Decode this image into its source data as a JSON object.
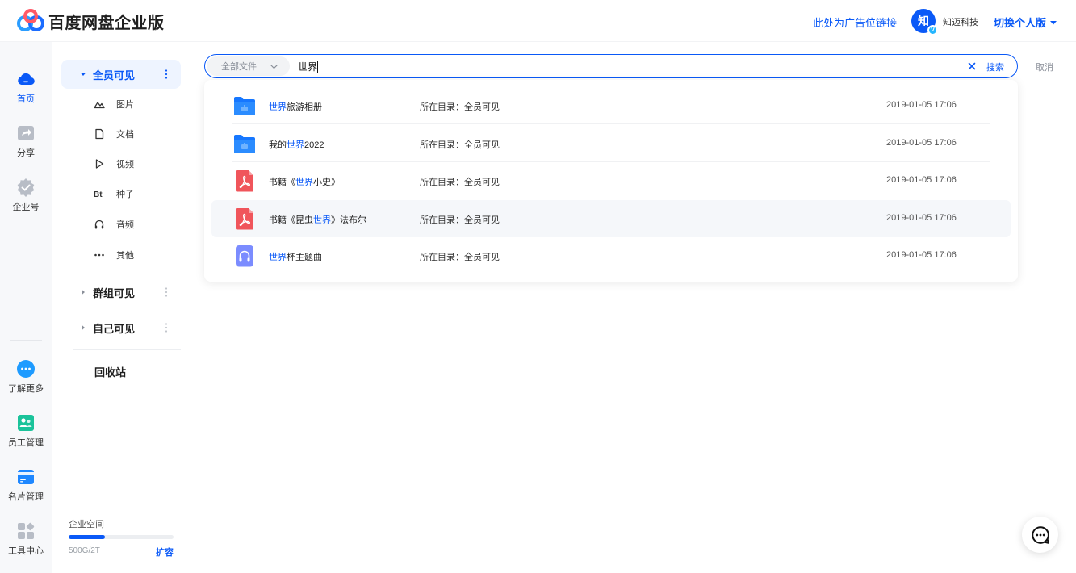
{
  "header": {
    "brand": "百度网盘企业版",
    "ad_link": "此处为广告位链接",
    "avatar_char": "知",
    "avatar_badge": "V",
    "company": "知迈科技",
    "switch_label": "切换个人版"
  },
  "rail": {
    "items": [
      {
        "label": "首页",
        "icon": "cloud-icon"
      },
      {
        "label": "分享",
        "icon": "share-icon"
      },
      {
        "label": "企业号",
        "icon": "badge-icon"
      },
      {
        "label": "了解更多",
        "icon": "more-chat-icon"
      },
      {
        "label": "员工管理",
        "icon": "staff-icon"
      },
      {
        "label": "名片管理",
        "icon": "card-icon"
      },
      {
        "label": "工具中心",
        "icon": "tools-icon"
      }
    ]
  },
  "sidebar": {
    "groups": [
      {
        "label": "全员可见"
      },
      {
        "label": "群组可见"
      },
      {
        "label": "自己可见"
      }
    ],
    "subitems": [
      {
        "label": "图片",
        "icon": "image-icon"
      },
      {
        "label": "文档",
        "icon": "document-icon"
      },
      {
        "label": "视频",
        "icon": "play-icon"
      },
      {
        "label": "种子",
        "icon": "bt-icon"
      },
      {
        "label": "音频",
        "icon": "headphones-icon"
      },
      {
        "label": "其他",
        "icon": "dots-icon"
      }
    ],
    "trash": "回收站",
    "storage": {
      "label": "企业空间",
      "usage": "500G/2T",
      "used_fraction": 0.25,
      "expand": "扩容"
    }
  },
  "search": {
    "scope": "全部文件",
    "query": "世界",
    "button": "搜索",
    "cancel": "取消"
  },
  "results": [
    {
      "parts": [
        {
          "text": "世界",
          "hl": true
        },
        {
          "text": "旅游相册",
          "hl": false
        }
      ],
      "location": "所在目录：全员可见",
      "time": "2019-01-05 17:06",
      "icon": "folder"
    },
    {
      "parts": [
        {
          "text": "我的",
          "hl": false
        },
        {
          "text": "世界",
          "hl": true
        },
        {
          "text": "2022",
          "hl": false
        }
      ],
      "location": "所在目录：全员可见",
      "time": "2019-01-05 17:06",
      "icon": "folder"
    },
    {
      "parts": [
        {
          "text": "书籍《",
          "hl": false
        },
        {
          "text": "世界",
          "hl": true
        },
        {
          "text": "小史》",
          "hl": false
        }
      ],
      "location": "所在目录：全员可见",
      "time": "2019-01-05 17:06",
      "icon": "pdf"
    },
    {
      "parts": [
        {
          "text": "书籍《昆虫",
          "hl": false
        },
        {
          "text": "世界",
          "hl": true
        },
        {
          "text": "》法布尔",
          "hl": false
        }
      ],
      "location": "所在目录：全员可见",
      "time": "2019-01-05 17:06",
      "icon": "pdf"
    },
    {
      "parts": [
        {
          "text": "世界",
          "hl": true
        },
        {
          "text": "杯主题曲",
          "hl": false
        }
      ],
      "location": "所在目录：全员可见",
      "time": "2019-01-05 17:06",
      "icon": "audio"
    }
  ],
  "colors": {
    "accent": "#0a59f7",
    "pdf": "#f0555b",
    "audio": "#7b8cff"
  }
}
